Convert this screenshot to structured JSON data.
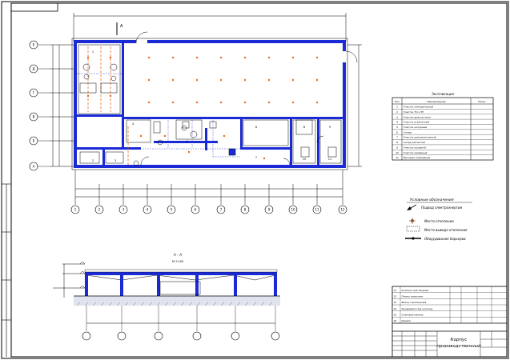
{
  "stamp_top": "",
  "plan": {
    "width_dim": "",
    "section_mark": "А",
    "axes_bottom": [
      "1",
      "2",
      "3",
      "4",
      "5",
      "6",
      "7",
      "8",
      "9",
      "10",
      "11",
      "12"
    ],
    "axes_left": [
      "Е",
      "Д",
      "Г",
      "В",
      "Б",
      "А"
    ],
    "rooms": [
      "1",
      "2",
      "3",
      "4",
      "5",
      "6",
      "7",
      "8",
      "9",
      "10",
      "11"
    ]
  },
  "explication": {
    "title": "Экспликация",
    "headers": [
      "Поз",
      "Наименование",
      "Площ."
    ],
    "rows": [
      [
        "1",
        "Участок электрический",
        ""
      ],
      [
        "2",
        "Участок ТО и ТР",
        ""
      ],
      [
        "3",
        "Участок диагностики",
        ""
      ],
      [
        "4",
        "Участок агрегатный",
        ""
      ],
      [
        "5",
        "Участок моторный",
        ""
      ],
      [
        "6",
        "Склад",
        ""
      ],
      [
        "7",
        "Участок шиномонтажный",
        ""
      ],
      [
        "8",
        "Склад запчастей",
        ""
      ],
      [
        "9",
        "Участок кузовной",
        ""
      ],
      [
        "10",
        "Участок малярный",
        ""
      ],
      [
        "11",
        "Бытовые помещения",
        ""
      ]
    ]
  },
  "legend": {
    "title": "Условные обозначения",
    "items": [
      "Подвод электроэнергии",
      "Место отопления",
      "Место вывода отопления",
      "Оборудование барьеров"
    ]
  },
  "section": {
    "title": "А – А",
    "scale": "М 1:100"
  },
  "stamp": {
    "code": "",
    "title_line1": "Корпус",
    "title_line2": "производственный",
    "spec_rows": [
      [
        "11",
        "Колонна ж/б сборная",
        "",
        "",
        "",
        ""
      ],
      [
        "12",
        "Плиты покрытия",
        "",
        "",
        "",
        ""
      ],
      [
        "13",
        "Балка стропильная",
        "",
        "",
        "",
        ""
      ],
      [
        "14",
        "Фундамент под колонну",
        "",
        "",
        "",
        ""
      ],
      [
        "15",
        "Стеновая панель",
        "",
        "",
        "",
        ""
      ],
      [
        "16",
        "Кровля",
        "",
        "",
        "",
        ""
      ]
    ]
  }
}
